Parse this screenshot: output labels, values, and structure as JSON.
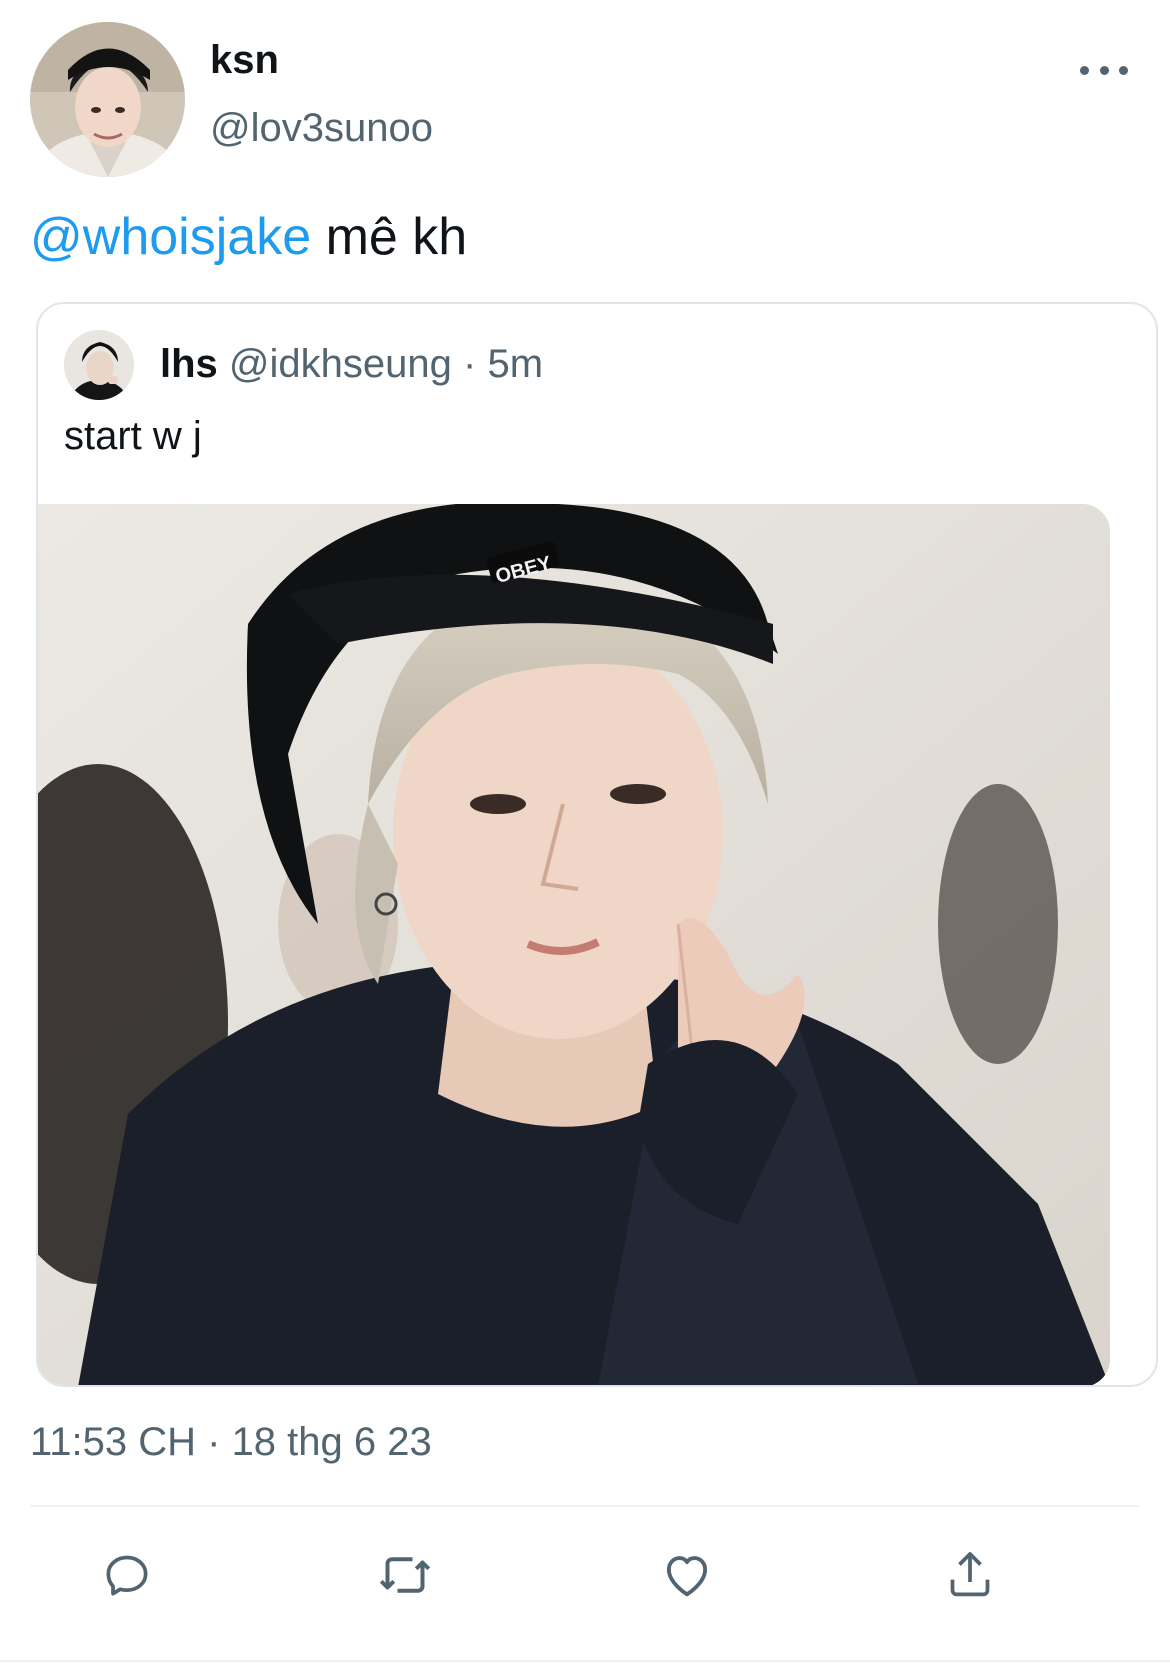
{
  "tweet": {
    "author": {
      "name": "ksn",
      "handle": "@lov3sunoo"
    },
    "mention": "@whoisjake",
    "text": " mê kh",
    "timestamp": "11:53 CH · 18 thg 6 23"
  },
  "quote": {
    "author_name": "lhs",
    "author_handle": "@idkhseung",
    "age": "5m",
    "separator": "·",
    "text": "start w j",
    "photo_caption": "OBEY"
  },
  "actions": [
    {
      "icon": "reply-icon"
    },
    {
      "icon": "retweet-icon"
    },
    {
      "icon": "like-icon"
    },
    {
      "icon": "share-icon"
    }
  ],
  "colors": {
    "mention": "#1d9bf0",
    "secondary_text": "#536471",
    "card_border": "#dfe5ea"
  }
}
